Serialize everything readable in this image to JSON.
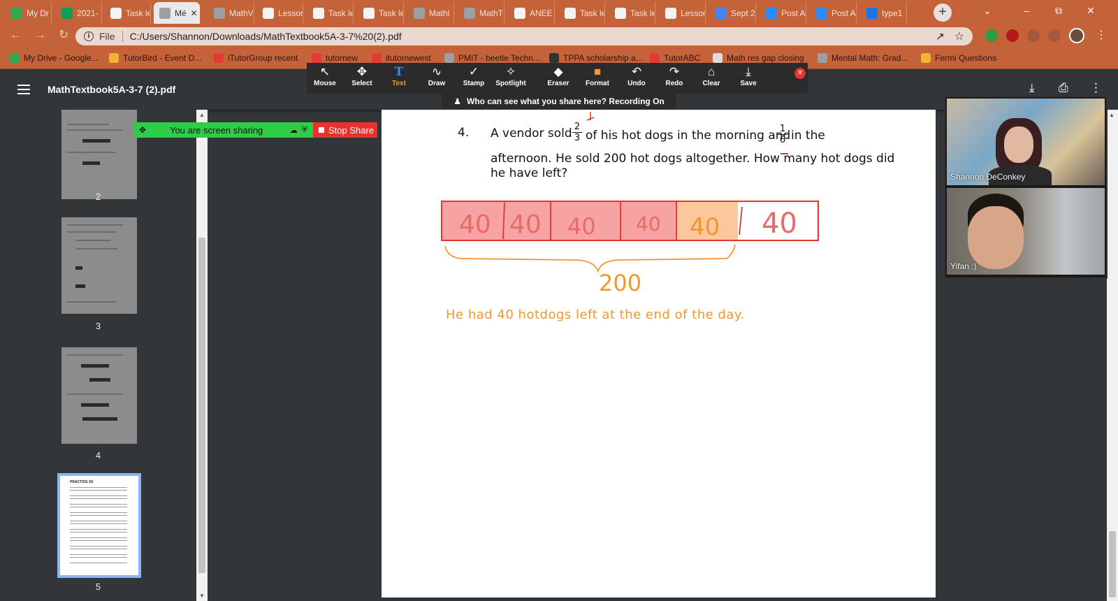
{
  "browser": {
    "tabs": [
      {
        "label": "My Dr",
        "color": "#34a853"
      },
      {
        "label": "2021-",
        "color": "#0f9d58"
      },
      {
        "label": "Task le",
        "color": "#f4f4f4"
      },
      {
        "label": "Mé",
        "color": "#9aa0a6"
      },
      {
        "label": "MathV",
        "color": "#9aa0a6"
      },
      {
        "label": "Lessor",
        "color": "#f4f4f4"
      },
      {
        "label": "Task le",
        "color": "#f4f4f4"
      },
      {
        "label": "Task le",
        "color": "#f4f4f4"
      },
      {
        "label": "Mathl",
        "color": "#9aa0a6"
      },
      {
        "label": "MathT",
        "color": "#9aa0a6"
      },
      {
        "label": "ANEE",
        "color": "#f4f4f4"
      },
      {
        "label": "Task le",
        "color": "#f4f4f4"
      },
      {
        "label": "Task le",
        "color": "#f4f4f4"
      },
      {
        "label": "Lessor",
        "color": "#f4f4f4"
      },
      {
        "label": "Sept 2",
        "color": "#4285f4"
      },
      {
        "label": "Post A",
        "color": "#2d8cff"
      },
      {
        "label": "Post A",
        "color": "#2d8cff"
      },
      {
        "label": "type1",
        "color": "#1a73e8"
      }
    ],
    "address": {
      "scheme": "File",
      "url": "C:/Users/Shannon/Downloads/MathTextbook5A-3-7%20(2).pdf"
    },
    "bookmarks": [
      {
        "label": "My Drive - Google...",
        "color": "#34a853"
      },
      {
        "label": "TutorBird - Event D...",
        "color": "#f2b233"
      },
      {
        "label": "iTutorGroup recent",
        "color": "#e53935"
      },
      {
        "label": "tutornew",
        "color": "#e53935"
      },
      {
        "label": "itutornewest",
        "color": "#e53935"
      },
      {
        "label": "PMIT - beetle Techn...",
        "color": "#9aa0a6"
      },
      {
        "label": "TPPA scholarship a...",
        "color": "#333333"
      },
      {
        "label": "TutorABC",
        "color": "#e53935"
      },
      {
        "label": "Math res gap closing",
        "color": "#dddddd"
      },
      {
        "label": "Mental Math: Grad...",
        "color": "#9aa0a6"
      },
      {
        "label": "Fermi Questions",
        "color": "#f2b233"
      }
    ]
  },
  "pdf": {
    "title": "MathTextbook5A-3-7 (2).pdf",
    "thumbnails": [
      "2",
      "3",
      "4",
      "5"
    ]
  },
  "annotate": {
    "tools": [
      {
        "label": "Mouse",
        "icon": "↖"
      },
      {
        "label": "Select",
        "icon": "✥"
      },
      {
        "label": "Text",
        "icon": "T"
      },
      {
        "label": "Draw",
        "icon": "∿"
      },
      {
        "label": "Stamp",
        "icon": "✓"
      },
      {
        "label": "Spotlight",
        "icon": "✧"
      },
      {
        "label": "Eraser",
        "icon": "◆"
      },
      {
        "label": "Format",
        "icon": "■"
      },
      {
        "label": "Undo",
        "icon": "↶"
      },
      {
        "label": "Redo",
        "icon": "↷"
      },
      {
        "label": "Clear",
        "icon": "⌂"
      },
      {
        "label": "Save",
        "icon": "⤓"
      }
    ],
    "who_can_see": "Who can see what you share here? Recording On",
    "sharing_text": "You are screen sharing",
    "stop_share": "Stop Share"
  },
  "problem": {
    "number": "4.",
    "part1": "A vendor sold",
    "frac1_num": "2",
    "frac1_den": "3",
    "part2": "of his hot dogs in the morning and",
    "frac2_num": "1",
    "frac2_den": "6",
    "part3": "in the",
    "line2": "afternoon. He sold 200 hot dogs altogether. How many hot dogs did",
    "line3": "he have left?"
  },
  "annotations": {
    "segments": [
      "40",
      "40",
      "40",
      "40",
      "40",
      "40"
    ],
    "total": "200",
    "answer": "He had 40 hotdogs left at the end of the day."
  },
  "participants": [
    {
      "name": "Shannon DeConkey"
    },
    {
      "name": "Yifan :)"
    }
  ]
}
